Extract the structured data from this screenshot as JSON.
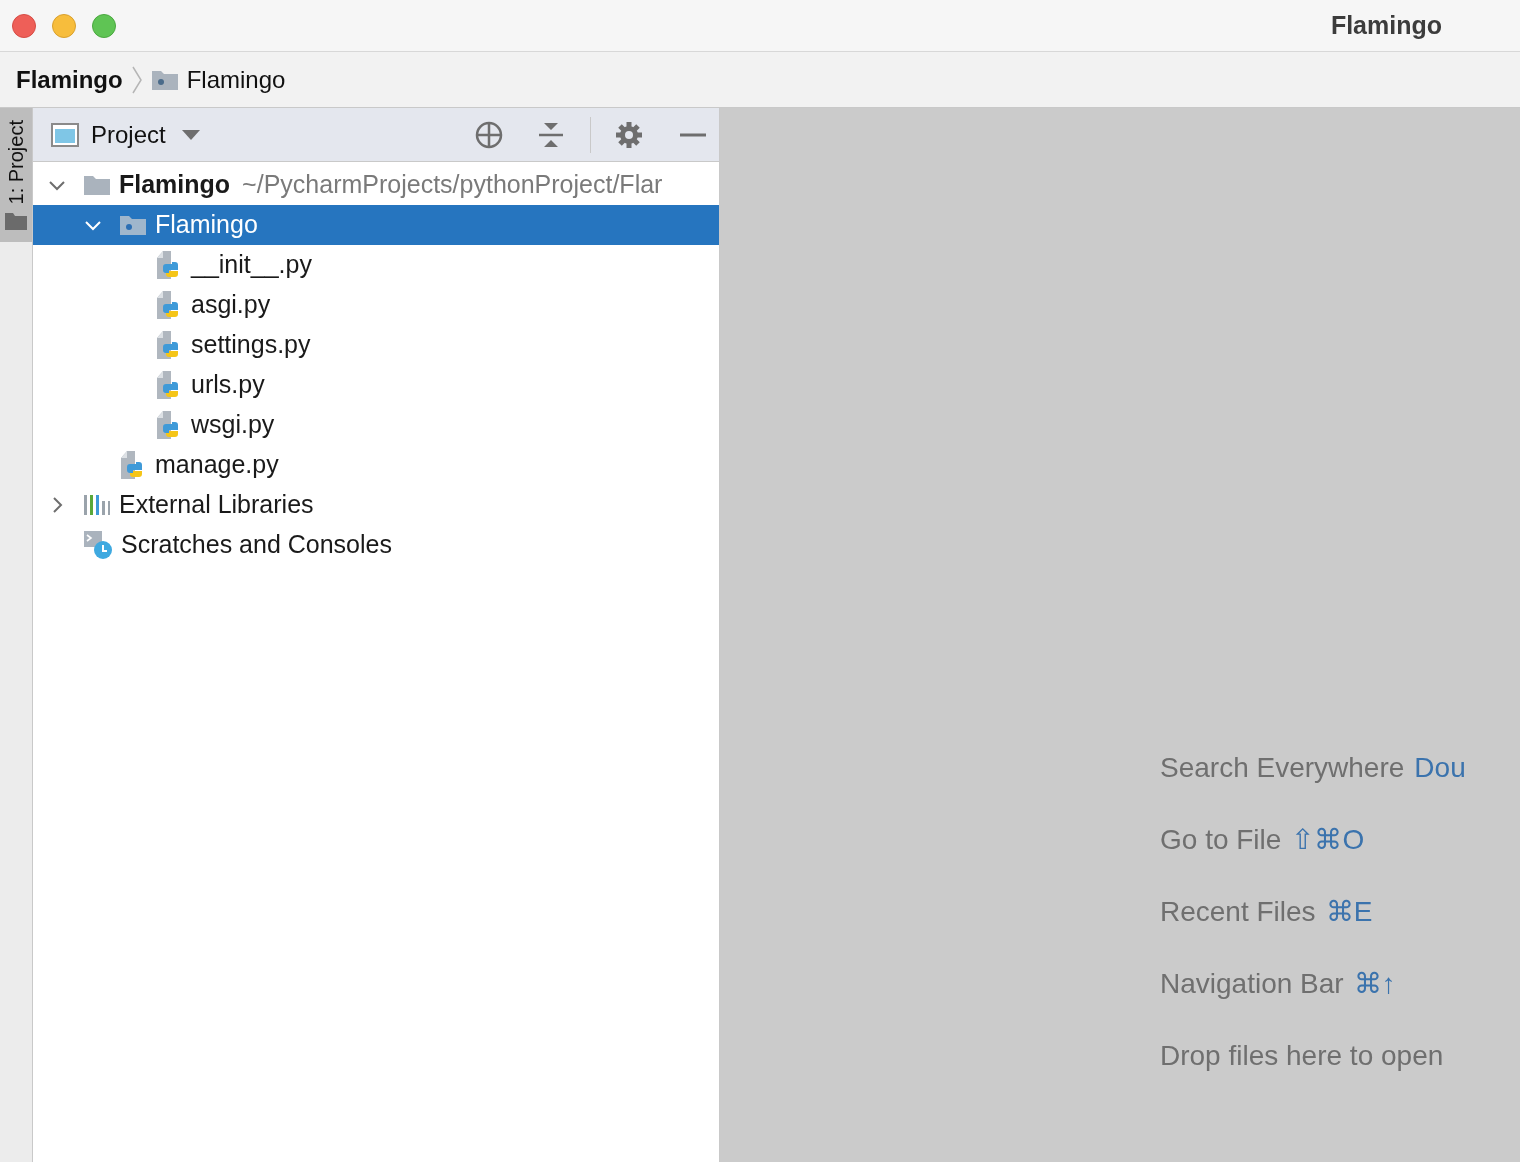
{
  "window": {
    "title": "Flamingo"
  },
  "breadcrumb": [
    {
      "label": "Flamingo",
      "kind": "project"
    },
    {
      "label": "Flamingo",
      "kind": "folder"
    }
  ],
  "side_tab": {
    "label": "1: Project",
    "selected": true
  },
  "panel": {
    "title": "Project"
  },
  "tree": [
    {
      "label": "Flamingo",
      "path": "~/PycharmProjects/pythonProject/Flar",
      "kind": "folder",
      "expanded": true,
      "selected": false,
      "children": [
        {
          "label": "Flamingo",
          "kind": "package",
          "expanded": true,
          "selected": true,
          "children": [
            {
              "label": "__init__.py",
              "kind": "python",
              "selected": false
            },
            {
              "label": "asgi.py",
              "kind": "python",
              "selected": false
            },
            {
              "label": "settings.py",
              "kind": "python",
              "selected": false
            },
            {
              "label": "urls.py",
              "kind": "python",
              "selected": false
            },
            {
              "label": "wsgi.py",
              "kind": "python",
              "selected": false
            }
          ]
        },
        {
          "label": "manage.py",
          "kind": "python",
          "selected": false
        }
      ]
    },
    {
      "label": "External Libraries",
      "kind": "libraries",
      "expanded": false,
      "selected": false
    },
    {
      "label": "Scratches and Consoles",
      "kind": "scratches",
      "selected": false
    }
  ],
  "hints": [
    {
      "label": "Search Everywhere",
      "shortcut": "Dou"
    },
    {
      "label": "Go to File",
      "shortcut": "⇧⌘O"
    },
    {
      "label": "Recent Files",
      "shortcut": "⌘E"
    },
    {
      "label": "Navigation Bar",
      "shortcut": "⌘↑"
    },
    {
      "label": "Drop files here to open"
    }
  ]
}
